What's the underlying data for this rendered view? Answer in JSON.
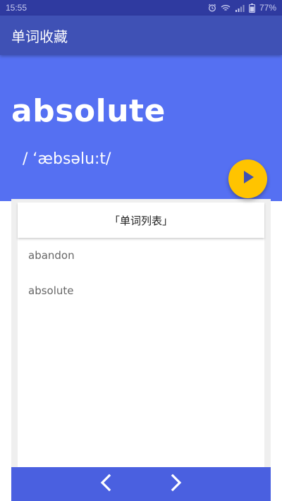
{
  "status_bar": {
    "time": "15:55",
    "battery": "77%"
  },
  "app_bar": {
    "title": "单词收藏"
  },
  "word_card": {
    "word": "absolute",
    "phonetic": "/ ‘æbsəlu:t/",
    "play_icon": "play-icon",
    "accent_color": "#ffc400",
    "background_color": "#5570f2"
  },
  "word_list": {
    "header": "「单词列表」",
    "items": [
      {
        "label": "abandon"
      },
      {
        "label": "absolute"
      }
    ]
  },
  "navigation": {
    "prev_icon": "chevron-left-icon",
    "next_icon": "chevron-right-icon",
    "bar_color": "#4a60e0"
  }
}
